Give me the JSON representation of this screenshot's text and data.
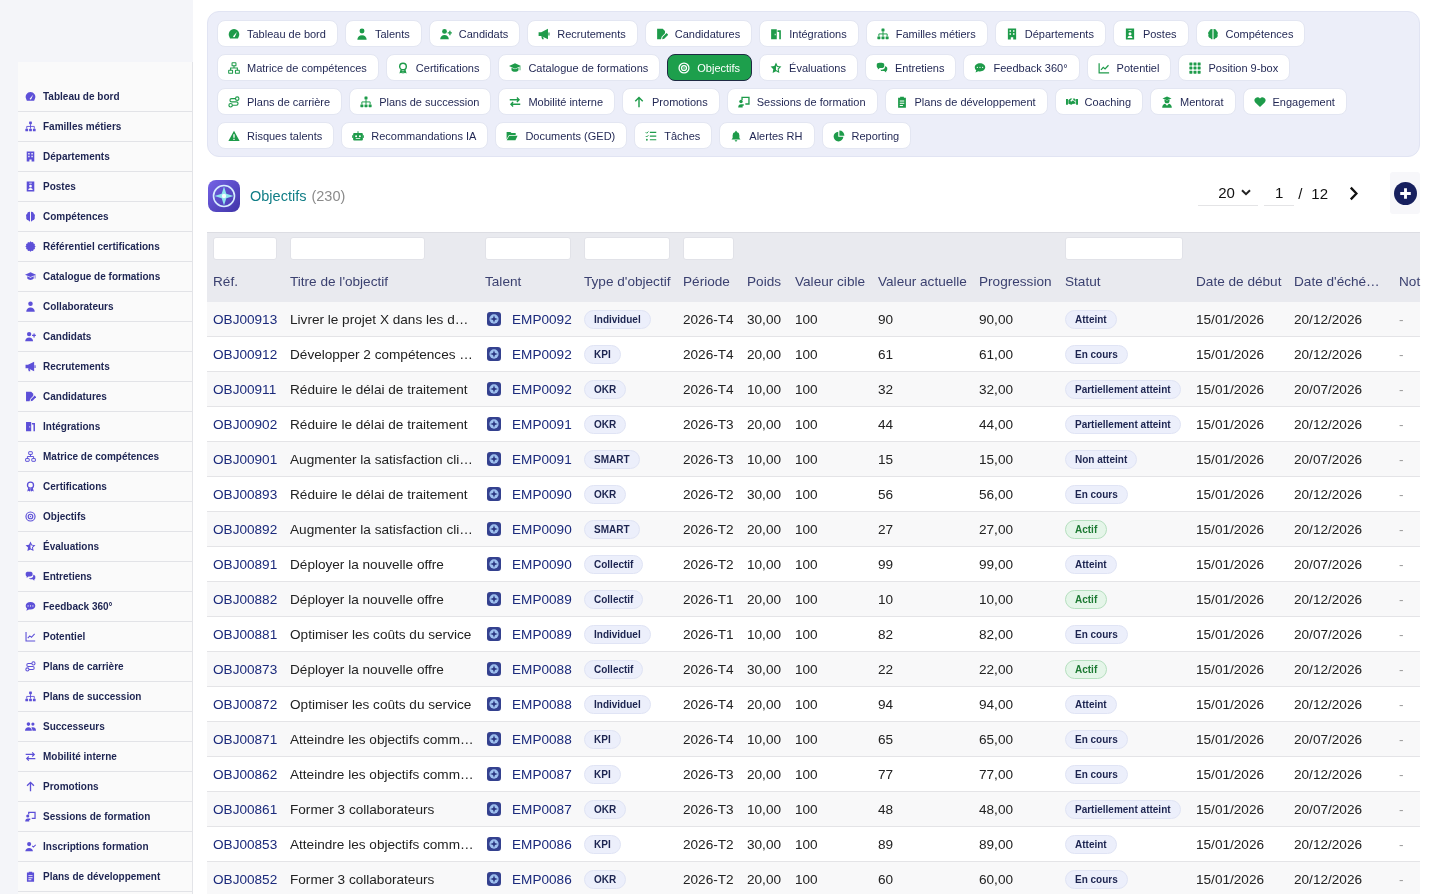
{
  "sidebar": {
    "items": [
      {
        "label": "Tableau de bord",
        "selected": false
      },
      {
        "label": "Familles métiers",
        "selected": false
      },
      {
        "label": "Départements",
        "selected": false
      },
      {
        "label": "Postes",
        "selected": false
      },
      {
        "label": "Compétences",
        "selected": false
      },
      {
        "label": "Référentiel certifications",
        "selected": false
      },
      {
        "label": "Catalogue de formations",
        "selected": false
      },
      {
        "label": "Collaborateurs",
        "selected": false
      },
      {
        "label": "Candidats",
        "selected": false
      },
      {
        "label": "Recrutements",
        "selected": false
      },
      {
        "label": "Candidatures",
        "selected": false
      },
      {
        "label": "Intégrations",
        "selected": false
      },
      {
        "label": "Matrice de compétences",
        "selected": false
      },
      {
        "label": "Certifications",
        "selected": false
      },
      {
        "label": "Objectifs",
        "selected": false
      },
      {
        "label": "Évaluations",
        "selected": false
      },
      {
        "label": "Entretiens",
        "selected": false
      },
      {
        "label": "Feedback 360°",
        "selected": false
      },
      {
        "label": "Potentiel",
        "selected": false
      },
      {
        "label": "Plans de carrière",
        "selected": false
      },
      {
        "label": "Plans de succession",
        "selected": false
      },
      {
        "label": "Successeurs",
        "selected": false
      },
      {
        "label": "Mobilité interne",
        "selected": false
      },
      {
        "label": "Promotions",
        "selected": false
      },
      {
        "label": "Sessions de formation",
        "selected": false
      },
      {
        "label": "Inscriptions formation",
        "selected": false
      },
      {
        "label": "Plans de développement",
        "selected": false
      }
    ]
  },
  "nav": {
    "items": [
      {
        "label": "Tableau de bord",
        "selected": false
      },
      {
        "label": "Talents",
        "selected": false
      },
      {
        "label": "Candidats",
        "selected": false
      },
      {
        "label": "Recrutements",
        "selected": false
      },
      {
        "label": "Candidatures",
        "selected": false
      },
      {
        "label": "Intégrations",
        "selected": false
      },
      {
        "label": "Familles métiers",
        "selected": false
      },
      {
        "label": "Départements",
        "selected": false
      },
      {
        "label": "Postes",
        "selected": false
      },
      {
        "label": "Compétences",
        "selected": false
      },
      {
        "label": "Matrice de compétences",
        "selected": false
      },
      {
        "label": "Certifications",
        "selected": false
      },
      {
        "label": "Catalogue de formations",
        "selected": false
      },
      {
        "label": "Objectifs",
        "selected": true
      },
      {
        "label": "Évaluations",
        "selected": false
      },
      {
        "label": "Entretiens",
        "selected": false
      },
      {
        "label": "Feedback 360°",
        "selected": false
      },
      {
        "label": "Potentiel",
        "selected": false
      },
      {
        "label": "Position 9-box",
        "selected": false
      },
      {
        "label": "Plans de carrière",
        "selected": false
      },
      {
        "label": "Plans de succession",
        "selected": false
      },
      {
        "label": "Mobilité interne",
        "selected": false
      },
      {
        "label": "Promotions",
        "selected": false
      },
      {
        "label": "Sessions de formation",
        "selected": false
      },
      {
        "label": "Plans de développement",
        "selected": false
      },
      {
        "label": "Coaching",
        "selected": false
      },
      {
        "label": "Mentorat",
        "selected": false
      },
      {
        "label": "Engagement",
        "selected": false
      },
      {
        "label": "Risques talents",
        "selected": false
      },
      {
        "label": "Recommandations IA",
        "selected": false
      },
      {
        "label": "Documents (GED)",
        "selected": false
      },
      {
        "label": "Tâches",
        "selected": false
      },
      {
        "label": "Alertes RH",
        "selected": false
      },
      {
        "label": "Reporting",
        "selected": false
      }
    ]
  },
  "header": {
    "title": "Objectifs",
    "count": "(230)"
  },
  "pagination": {
    "page_size": "20",
    "page": "1",
    "separator": "/",
    "total_pages": "12"
  },
  "table": {
    "columns": [
      {
        "label": "Réf.",
        "filter": true
      },
      {
        "label": "Titre de l'objectif",
        "filter": true
      },
      {
        "label": "Talent",
        "filter": true
      },
      {
        "label": "Type d'objectif",
        "filter": true
      },
      {
        "label": "Période",
        "filter": true
      },
      {
        "label": "Poids",
        "filter": false
      },
      {
        "label": "Valeur cible",
        "filter": false
      },
      {
        "label": "Valeur actuelle",
        "filter": false
      },
      {
        "label": "Progression",
        "filter": false
      },
      {
        "label": "Statut",
        "filter": true
      },
      {
        "label": "Date de début",
        "filter": false
      },
      {
        "label": "Date d'éché…",
        "filter": false
      },
      {
        "label": "Not",
        "filter": false
      }
    ],
    "rows": [
      {
        "ref": "OBJ00913",
        "title": "Livrer le projet X dans les d…",
        "talent": "EMP0092",
        "type": "Individuel",
        "period": "2026-T4",
        "weight": "30,00",
        "target": "100",
        "current": "90",
        "progress": "90,00",
        "status": {
          "label": "Atteint",
          "kind": "neutral"
        },
        "start": "15/01/2026",
        "due": "20/12/2026",
        "notes": "-"
      },
      {
        "ref": "OBJ00912",
        "title": "Développer 2 compétences …",
        "talent": "EMP0092",
        "type": "KPI",
        "period": "2026-T4",
        "weight": "20,00",
        "target": "100",
        "current": "61",
        "progress": "61,00",
        "status": {
          "label": "En cours",
          "kind": "neutral"
        },
        "start": "15/01/2026",
        "due": "20/12/2026",
        "notes": "-"
      },
      {
        "ref": "OBJ00911",
        "title": "Réduire le délai de traitement",
        "talent": "EMP0092",
        "type": "OKR",
        "period": "2026-T4",
        "weight": "10,00",
        "target": "100",
        "current": "32",
        "progress": "32,00",
        "status": {
          "label": "Partiellement atteint",
          "kind": "neutral"
        },
        "start": "15/01/2026",
        "due": "20/07/2026",
        "notes": "-"
      },
      {
        "ref": "OBJ00902",
        "title": "Réduire le délai de traitement",
        "talent": "EMP0091",
        "type": "OKR",
        "period": "2026-T3",
        "weight": "20,00",
        "target": "100",
        "current": "44",
        "progress": "44,00",
        "status": {
          "label": "Partiellement atteint",
          "kind": "neutral"
        },
        "start": "15/01/2026",
        "due": "20/12/2026",
        "notes": "-"
      },
      {
        "ref": "OBJ00901",
        "title": "Augmenter la satisfaction cli…",
        "talent": "EMP0091",
        "type": "SMART",
        "period": "2026-T3",
        "weight": "10,00",
        "target": "100",
        "current": "15",
        "progress": "15,00",
        "status": {
          "label": "Non atteint",
          "kind": "neutral"
        },
        "start": "15/01/2026",
        "due": "20/07/2026",
        "notes": "-"
      },
      {
        "ref": "OBJ00893",
        "title": "Réduire le délai de traitement",
        "talent": "EMP0090",
        "type": "OKR",
        "period": "2026-T2",
        "weight": "30,00",
        "target": "100",
        "current": "56",
        "progress": "56,00",
        "status": {
          "label": "En cours",
          "kind": "neutral"
        },
        "start": "15/01/2026",
        "due": "20/12/2026",
        "notes": "-"
      },
      {
        "ref": "OBJ00892",
        "title": "Augmenter la satisfaction cli…",
        "talent": "EMP0090",
        "type": "SMART",
        "period": "2026-T2",
        "weight": "20,00",
        "target": "100",
        "current": "27",
        "progress": "27,00",
        "status": {
          "label": "Actif",
          "kind": "success"
        },
        "start": "15/01/2026",
        "due": "20/12/2026",
        "notes": "-"
      },
      {
        "ref": "OBJ00891",
        "title": "Déployer la nouvelle offre",
        "talent": "EMP0090",
        "type": "Collectif",
        "period": "2026-T2",
        "weight": "10,00",
        "target": "100",
        "current": "99",
        "progress": "99,00",
        "status": {
          "label": "Atteint",
          "kind": "neutral"
        },
        "start": "15/01/2026",
        "due": "20/07/2026",
        "notes": "-"
      },
      {
        "ref": "OBJ00882",
        "title": "Déployer la nouvelle offre",
        "talent": "EMP0089",
        "type": "Collectif",
        "period": "2026-T1",
        "weight": "20,00",
        "target": "100",
        "current": "10",
        "progress": "10,00",
        "status": {
          "label": "Actif",
          "kind": "success"
        },
        "start": "15/01/2026",
        "due": "20/12/2026",
        "notes": "-"
      },
      {
        "ref": "OBJ00881",
        "title": "Optimiser les coûts du service",
        "talent": "EMP0089",
        "type": "Individuel",
        "period": "2026-T1",
        "weight": "10,00",
        "target": "100",
        "current": "82",
        "progress": "82,00",
        "status": {
          "label": "En cours",
          "kind": "neutral"
        },
        "start": "15/01/2026",
        "due": "20/07/2026",
        "notes": "-"
      },
      {
        "ref": "OBJ00873",
        "title": "Déployer la nouvelle offre",
        "talent": "EMP0088",
        "type": "Collectif",
        "period": "2026-T4",
        "weight": "30,00",
        "target": "100",
        "current": "22",
        "progress": "22,00",
        "status": {
          "label": "Actif",
          "kind": "success"
        },
        "start": "15/01/2026",
        "due": "20/12/2026",
        "notes": "-"
      },
      {
        "ref": "OBJ00872",
        "title": "Optimiser les coûts du service",
        "talent": "EMP0088",
        "type": "Individuel",
        "period": "2026-T4",
        "weight": "20,00",
        "target": "100",
        "current": "94",
        "progress": "94,00",
        "status": {
          "label": "Atteint",
          "kind": "neutral"
        },
        "start": "15/01/2026",
        "due": "20/12/2026",
        "notes": "-"
      },
      {
        "ref": "OBJ00871",
        "title": "Atteindre les objectifs comm…",
        "talent": "EMP0088",
        "type": "KPI",
        "period": "2026-T4",
        "weight": "10,00",
        "target": "100",
        "current": "65",
        "progress": "65,00",
        "status": {
          "label": "En cours",
          "kind": "neutral"
        },
        "start": "15/01/2026",
        "due": "20/07/2026",
        "notes": "-"
      },
      {
        "ref": "OBJ00862",
        "title": "Atteindre les objectifs comm…",
        "talent": "EMP0087",
        "type": "KPI",
        "period": "2026-T3",
        "weight": "20,00",
        "target": "100",
        "current": "77",
        "progress": "77,00",
        "status": {
          "label": "En cours",
          "kind": "neutral"
        },
        "start": "15/01/2026",
        "due": "20/12/2026",
        "notes": "-"
      },
      {
        "ref": "OBJ00861",
        "title": "Former 3 collaborateurs",
        "talent": "EMP0087",
        "type": "OKR",
        "period": "2026-T3",
        "weight": "10,00",
        "target": "100",
        "current": "48",
        "progress": "48,00",
        "status": {
          "label": "Partiellement atteint",
          "kind": "neutral"
        },
        "start": "15/01/2026",
        "due": "20/07/2026",
        "notes": "-"
      },
      {
        "ref": "OBJ00853",
        "title": "Atteindre les objectifs comm…",
        "talent": "EMP0086",
        "type": "KPI",
        "period": "2026-T2",
        "weight": "30,00",
        "target": "100",
        "current": "89",
        "progress": "89,00",
        "status": {
          "label": "Atteint",
          "kind": "neutral"
        },
        "start": "15/01/2026",
        "due": "20/12/2026",
        "notes": "-"
      },
      {
        "ref": "OBJ00852",
        "title": "Former 3 collaborateurs",
        "talent": "EMP0086",
        "type": "OKR",
        "period": "2026-T2",
        "weight": "20,00",
        "target": "100",
        "current": "60",
        "progress": "60,00",
        "status": {
          "label": "En cours",
          "kind": "neutral"
        },
        "start": "15/01/2026",
        "due": "20/12/2026",
        "notes": "-"
      }
    ]
  }
}
